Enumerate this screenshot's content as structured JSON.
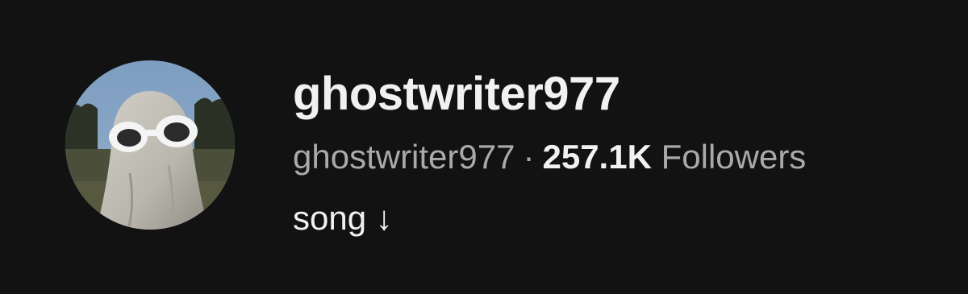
{
  "channel": {
    "display_name": "ghostwriter977",
    "handle": "ghostwriter977",
    "separator": "·",
    "followers_count": "257.1K",
    "followers_label": "Followers",
    "bio": "song ↓"
  },
  "colors": {
    "background": "#121212",
    "primary_text": "#f1f1f1",
    "secondary_text": "#aaaaaa"
  },
  "avatar": {
    "icon": "ghost-with-sunglasses-photo"
  }
}
